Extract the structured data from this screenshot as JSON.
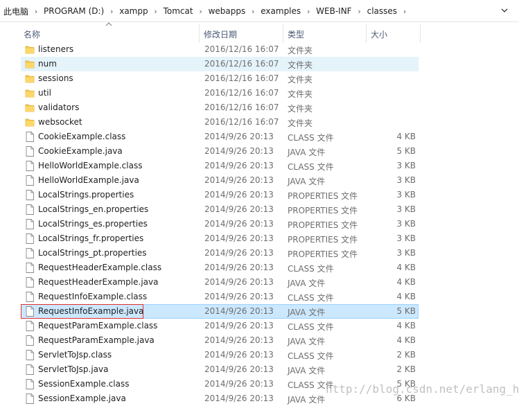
{
  "breadcrumb": [
    "此电脑",
    "PROGRAM (D:)",
    "xampp",
    "Tomcat",
    "webapps",
    "examples",
    "WEB-INF",
    "classes"
  ],
  "columns": {
    "name": "名称",
    "date": "修改日期",
    "type": "类型",
    "size": "大小"
  },
  "files": [
    {
      "name": "listeners",
      "date": "2016/12/16 16:07",
      "type": "文件夹",
      "size": "",
      "kind": "folder"
    },
    {
      "name": "num",
      "date": "2016/12/16 16:07",
      "type": "文件夹",
      "size": "",
      "kind": "folder",
      "state": "hover"
    },
    {
      "name": "sessions",
      "date": "2016/12/16 16:07",
      "type": "文件夹",
      "size": "",
      "kind": "folder"
    },
    {
      "name": "util",
      "date": "2016/12/16 16:07",
      "type": "文件夹",
      "size": "",
      "kind": "folder"
    },
    {
      "name": "validators",
      "date": "2016/12/16 16:07",
      "type": "文件夹",
      "size": "",
      "kind": "folder"
    },
    {
      "name": "websocket",
      "date": "2016/12/16 16:07",
      "type": "文件夹",
      "size": "",
      "kind": "folder"
    },
    {
      "name": "CookieExample.class",
      "date": "2014/9/26 20:13",
      "type": "CLASS 文件",
      "size": "4 KB",
      "kind": "file"
    },
    {
      "name": "CookieExample.java",
      "date": "2014/9/26 20:13",
      "type": "JAVA 文件",
      "size": "5 KB",
      "kind": "file"
    },
    {
      "name": "HelloWorldExample.class",
      "date": "2014/9/26 20:13",
      "type": "CLASS 文件",
      "size": "3 KB",
      "kind": "file"
    },
    {
      "name": "HelloWorldExample.java",
      "date": "2014/9/26 20:13",
      "type": "JAVA 文件",
      "size": "3 KB",
      "kind": "file"
    },
    {
      "name": "LocalStrings.properties",
      "date": "2014/9/26 20:13",
      "type": "PROPERTIES 文件",
      "size": "3 KB",
      "kind": "file"
    },
    {
      "name": "LocalStrings_en.properties",
      "date": "2014/9/26 20:13",
      "type": "PROPERTIES 文件",
      "size": "3 KB",
      "kind": "file"
    },
    {
      "name": "LocalStrings_es.properties",
      "date": "2014/9/26 20:13",
      "type": "PROPERTIES 文件",
      "size": "3 KB",
      "kind": "file"
    },
    {
      "name": "LocalStrings_fr.properties",
      "date": "2014/9/26 20:13",
      "type": "PROPERTIES 文件",
      "size": "3 KB",
      "kind": "file"
    },
    {
      "name": "LocalStrings_pt.properties",
      "date": "2014/9/26 20:13",
      "type": "PROPERTIES 文件",
      "size": "3 KB",
      "kind": "file"
    },
    {
      "name": "RequestHeaderExample.class",
      "date": "2014/9/26 20:13",
      "type": "CLASS 文件",
      "size": "4 KB",
      "kind": "file"
    },
    {
      "name": "RequestHeaderExample.java",
      "date": "2014/9/26 20:13",
      "type": "JAVA 文件",
      "size": "4 KB",
      "kind": "file"
    },
    {
      "name": "RequestInfoExample.class",
      "date": "2014/9/26 20:13",
      "type": "CLASS 文件",
      "size": "4 KB",
      "kind": "file"
    },
    {
      "name": "RequestInfoExample.java",
      "date": "2014/9/26 20:13",
      "type": "JAVA 文件",
      "size": "5 KB",
      "kind": "file",
      "state": "selected"
    },
    {
      "name": "RequestParamExample.class",
      "date": "2014/9/26 20:13",
      "type": "CLASS 文件",
      "size": "4 KB",
      "kind": "file"
    },
    {
      "name": "RequestParamExample.java",
      "date": "2014/9/26 20:13",
      "type": "JAVA 文件",
      "size": "4 KB",
      "kind": "file"
    },
    {
      "name": "ServletToJsp.class",
      "date": "2014/9/26 20:13",
      "type": "CLASS 文件",
      "size": "2 KB",
      "kind": "file"
    },
    {
      "name": "ServletToJsp.java",
      "date": "2014/9/26 20:13",
      "type": "JAVA 文件",
      "size": "2 KB",
      "kind": "file"
    },
    {
      "name": "SessionExample.class",
      "date": "2014/9/26 20:13",
      "type": "CLASS 文件",
      "size": "5 KB",
      "kind": "file"
    },
    {
      "name": "SessionExample.java",
      "date": "2014/9/26 20:13",
      "type": "JAVA 文件",
      "size": "6 KB",
      "kind": "file"
    }
  ],
  "watermark": "http://blog.csdn.net/erlang_hell",
  "colors": {
    "folder": "#f6c94c",
    "hover": "#e5f3fb",
    "selected": "#cce8ff",
    "highlight_outline": "#e03030",
    "header_text": "#4a5a75"
  },
  "icons": {
    "folder": "folder-icon",
    "file": "file-icon",
    "separator": "chevron-right-icon",
    "dropdown": "chevron-down-icon",
    "sort": "sort-up-icon"
  }
}
